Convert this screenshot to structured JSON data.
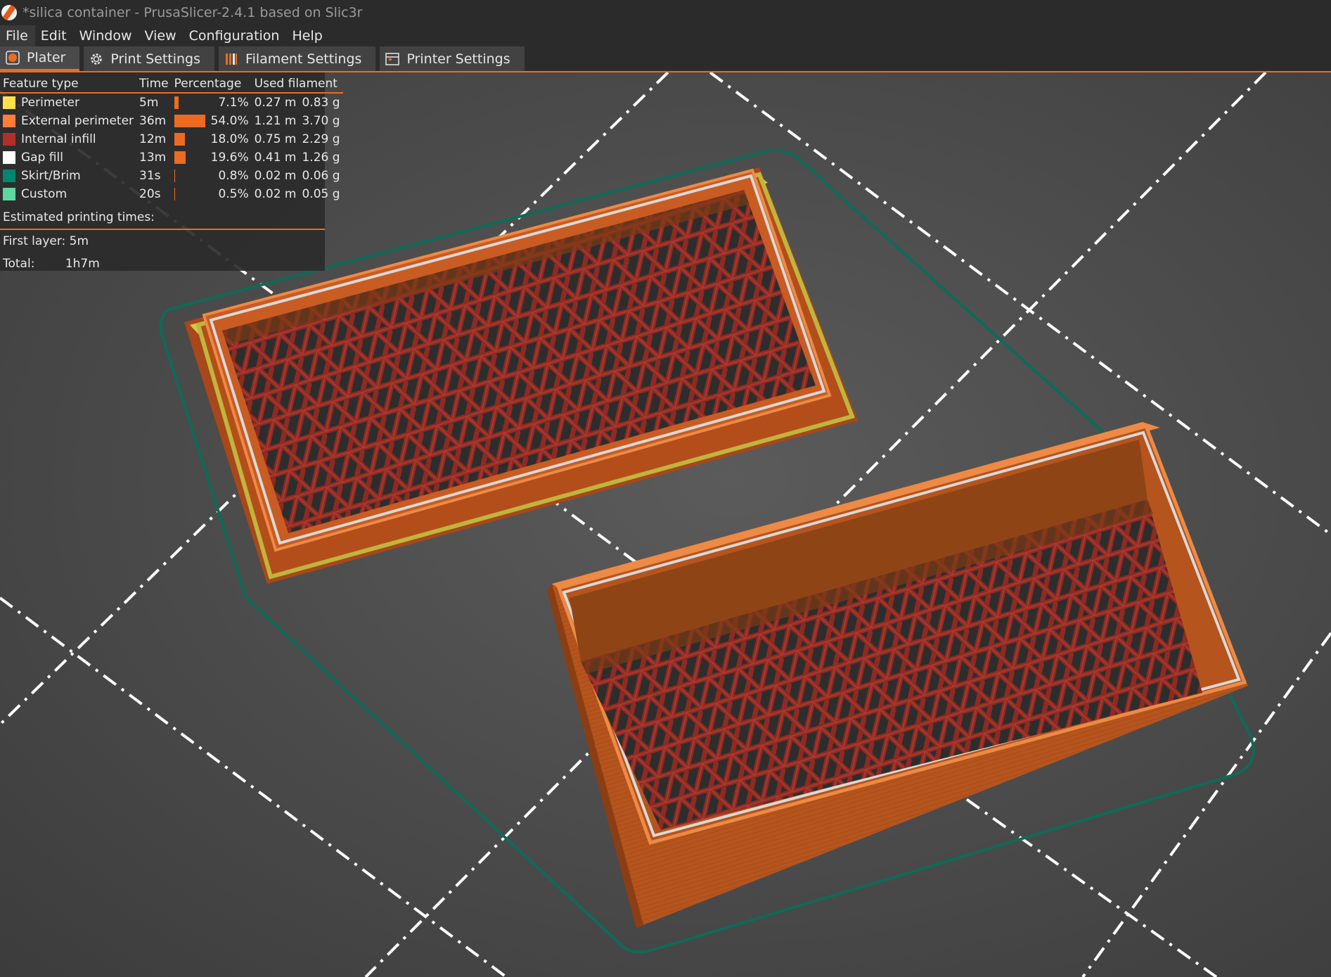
{
  "window": {
    "title": "*silica container - PrusaSlicer-2.4.1 based on Slic3r"
  },
  "menu": [
    {
      "label": "File",
      "active": true
    },
    {
      "label": "Edit",
      "active": false
    },
    {
      "label": "Window",
      "active": false
    },
    {
      "label": "View",
      "active": false
    },
    {
      "label": "Configuration",
      "active": false
    },
    {
      "label": "Help",
      "active": false
    }
  ],
  "tabs": [
    {
      "label": "Plater",
      "icon": "plater-icon"
    },
    {
      "label": "Print Settings",
      "icon": "gear-icon"
    },
    {
      "label": "Filament Settings",
      "icon": "filament-spool-icon"
    },
    {
      "label": "Printer Settings",
      "icon": "printer-icon"
    }
  ],
  "legend": {
    "headers": {
      "feature": "Feature type",
      "time": "Time",
      "percentage": "Percentage",
      "used": "Used filament"
    },
    "rows": [
      {
        "feature": "Perimeter",
        "color": "#ffe14a",
        "time": "5m",
        "percent": 7.1,
        "percent_label": "7.1%",
        "length": "0.27 m",
        "weight": "0.83 g"
      },
      {
        "feature": "External perimeter",
        "color": "#ff7d38",
        "time": "36m",
        "percent": 54.0,
        "percent_label": "54.0%",
        "length": "1.21 m",
        "weight": "3.70 g"
      },
      {
        "feature": "Internal infill",
        "color": "#b03029",
        "time": "12m",
        "percent": 18.0,
        "percent_label": "18.0%",
        "length": "0.75 m",
        "weight": "2.29 g"
      },
      {
        "feature": "Gap fill",
        "color": "#ffffff",
        "time": "13m",
        "percent": 19.6,
        "percent_label": "19.6%",
        "length": "0.41 m",
        "weight": "1.26 g"
      },
      {
        "feature": "Skirt/Brim",
        "color": "#00876e",
        "time": "31s",
        "percent": 0.8,
        "percent_label": "0.8%",
        "length": "0.02 m",
        "weight": "0.06 g"
      },
      {
        "feature": "Custom",
        "color": "#5ed69f",
        "time": "20s",
        "percent": 0.5,
        "percent_label": "0.5%",
        "length": "0.02 m",
        "weight": "0.05 g"
      }
    ],
    "estimated_label": "Estimated printing times:",
    "first_layer_label": "First layer:",
    "first_layer_value": "5m",
    "total_label": "Total:",
    "total_value": "1h7m"
  },
  "colors": {
    "accent": "#ed6b21",
    "external_perimeter_wall": "#b5531c",
    "infill": "#8e2a22",
    "skirt": "#0d6b57",
    "bed_grid": "#ffffff"
  }
}
